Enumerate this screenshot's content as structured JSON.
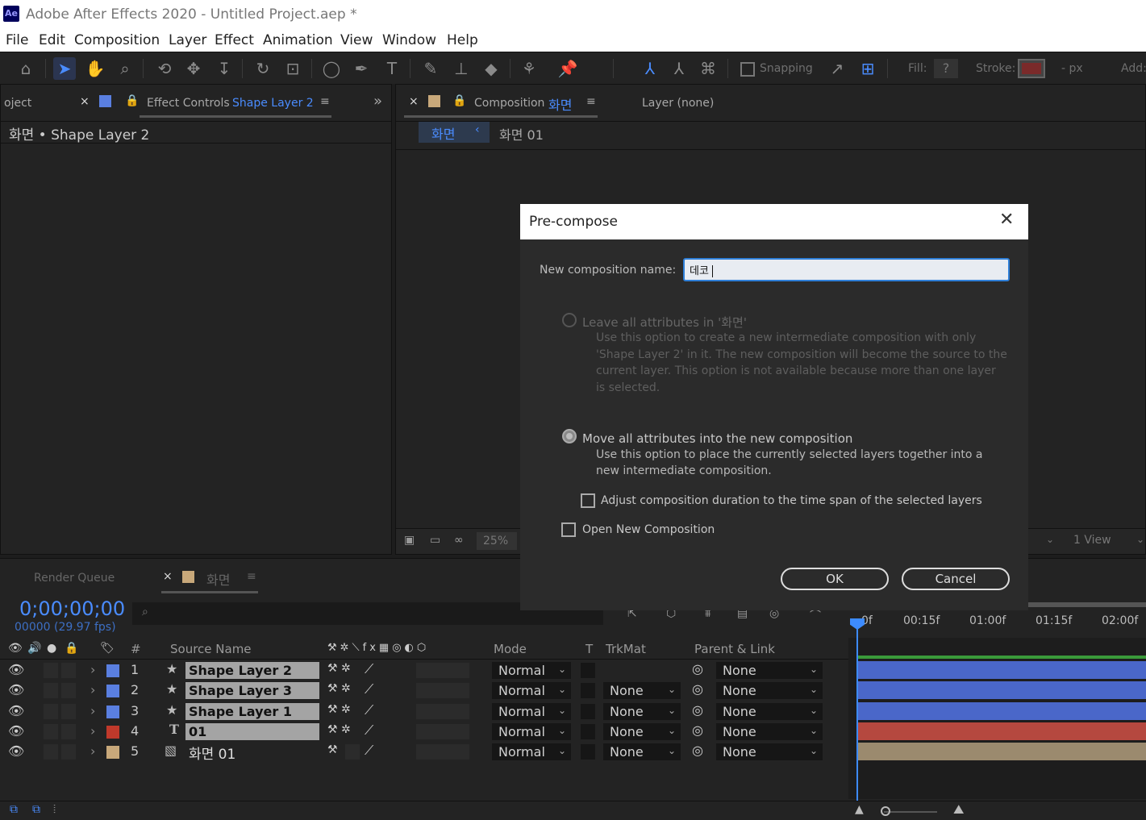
{
  "app": {
    "title": "Adobe After Effects 2020 - Untitled Project.aep *",
    "logo": "Ae"
  },
  "menu": [
    "File",
    "Edit",
    "Composition",
    "Layer",
    "Effect",
    "Animation",
    "View",
    "Window",
    "Help"
  ],
  "toolbar": {
    "snapping": "Snapping",
    "fill": "Fill:",
    "fill_value": "?",
    "stroke": "Stroke:",
    "stroke_unit": "-  px",
    "add": "Add:"
  },
  "left_panel": {
    "tab_project": "oject",
    "tab_effect_controls": "Effect Controls",
    "tab_effect_layer": "Shape Layer 2",
    "breadcrumb": "화면 • Shape Layer 2"
  },
  "comp_panel": {
    "tab_label": "Composition",
    "tab_comp_name": "화면",
    "layer_tab": "Layer (none)",
    "crumb_active": "화면",
    "crumb_next": "화면 01",
    "zoom": "25%",
    "view": "1 View"
  },
  "timeline": {
    "render_queue": "Render Queue",
    "comp_tab": "화면",
    "timecode": "0;00;00;00",
    "fps": "00000 (29.97 fps)",
    "ruler": [
      "0f",
      "00:15f",
      "01:00f",
      "01:15f",
      "02:00f"
    ],
    "headers": {
      "num": "#",
      "source": "Source Name",
      "mode": "Mode",
      "t": "T",
      "trkmat": "TrkMat",
      "parent": "Parent & Link"
    },
    "layers": [
      {
        "num": "1",
        "name": "Shape Layer 2",
        "type": "star",
        "color": "#5a7fe0",
        "mode": "Normal",
        "trkmat": "",
        "parent": "None",
        "bar": "#4a67c9"
      },
      {
        "num": "2",
        "name": "Shape Layer 3",
        "type": "star",
        "color": "#5a7fe0",
        "mode": "Normal",
        "trkmat": "None",
        "parent": "None",
        "bar": "#4a67c9"
      },
      {
        "num": "3",
        "name": "Shape Layer 1",
        "type": "star",
        "color": "#5a7fe0",
        "mode": "Normal",
        "trkmat": "None",
        "parent": "None",
        "bar": "#4a67c9"
      },
      {
        "num": "4",
        "name": "01",
        "type": "T",
        "color": "#c0392b",
        "mode": "Normal",
        "trkmat": "None",
        "parent": "None",
        "bar": "#b5483f"
      },
      {
        "num": "5",
        "name": "화면 01",
        "type": "comp",
        "color": "#c8a87a",
        "mode": "Normal",
        "trkmat": "None",
        "parent": "None",
        "bar": "#9b8a6e"
      }
    ]
  },
  "dialog": {
    "title": "Pre-compose",
    "name_label": "New composition name:",
    "name_value": "데코",
    "opt1_label": "Leave all attributes in '화면'",
    "opt1_desc": "Use this option to create a new intermediate composition with only 'Shape Layer 2' in it. The new composition will become the source to the current layer. This option is not available because more than one layer is selected.",
    "opt2_label": "Move all attributes into the new composition",
    "opt2_desc": "Use this option to place the currently selected layers together into a new intermediate composition.",
    "adjust_label": "Adjust composition duration to the time span of the selected layers",
    "open_label": "Open New Composition",
    "ok": "OK",
    "cancel": "Cancel"
  }
}
